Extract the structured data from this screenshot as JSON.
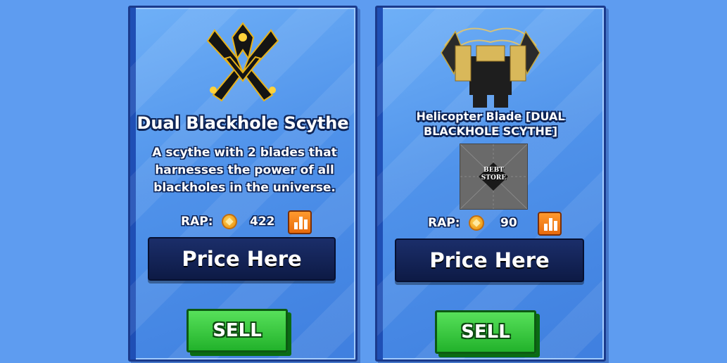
{
  "cards": [
    {
      "title": "Dual Blackhole Scythe",
      "description": "A scythe with 2 blades that harnesses the power of all blackholes in the universe.",
      "rap_label": "RAP:",
      "rap_value": "422",
      "price_label": "Price Here",
      "sell_label": "SELL",
      "image_icon": "blackhole-scythe-icon"
    },
    {
      "title": "Helicopter Blade [DUAL BLACKHOLE SCYTHE]",
      "store_logo_line1": "BEBT",
      "store_logo_line2": "STORE",
      "rap_label": "RAP:",
      "rap_value": "90",
      "price_label": "Price Here",
      "sell_label": "SELL",
      "image_icon": "helicopter-blade-icon"
    }
  ],
  "colors": {
    "background": "#5e9cf0",
    "card": "#4f92ea",
    "price_box": "#0d1a45",
    "sell_button": "#22b22b",
    "stats_button": "#e86a0c",
    "coin": "#f0a01c"
  }
}
